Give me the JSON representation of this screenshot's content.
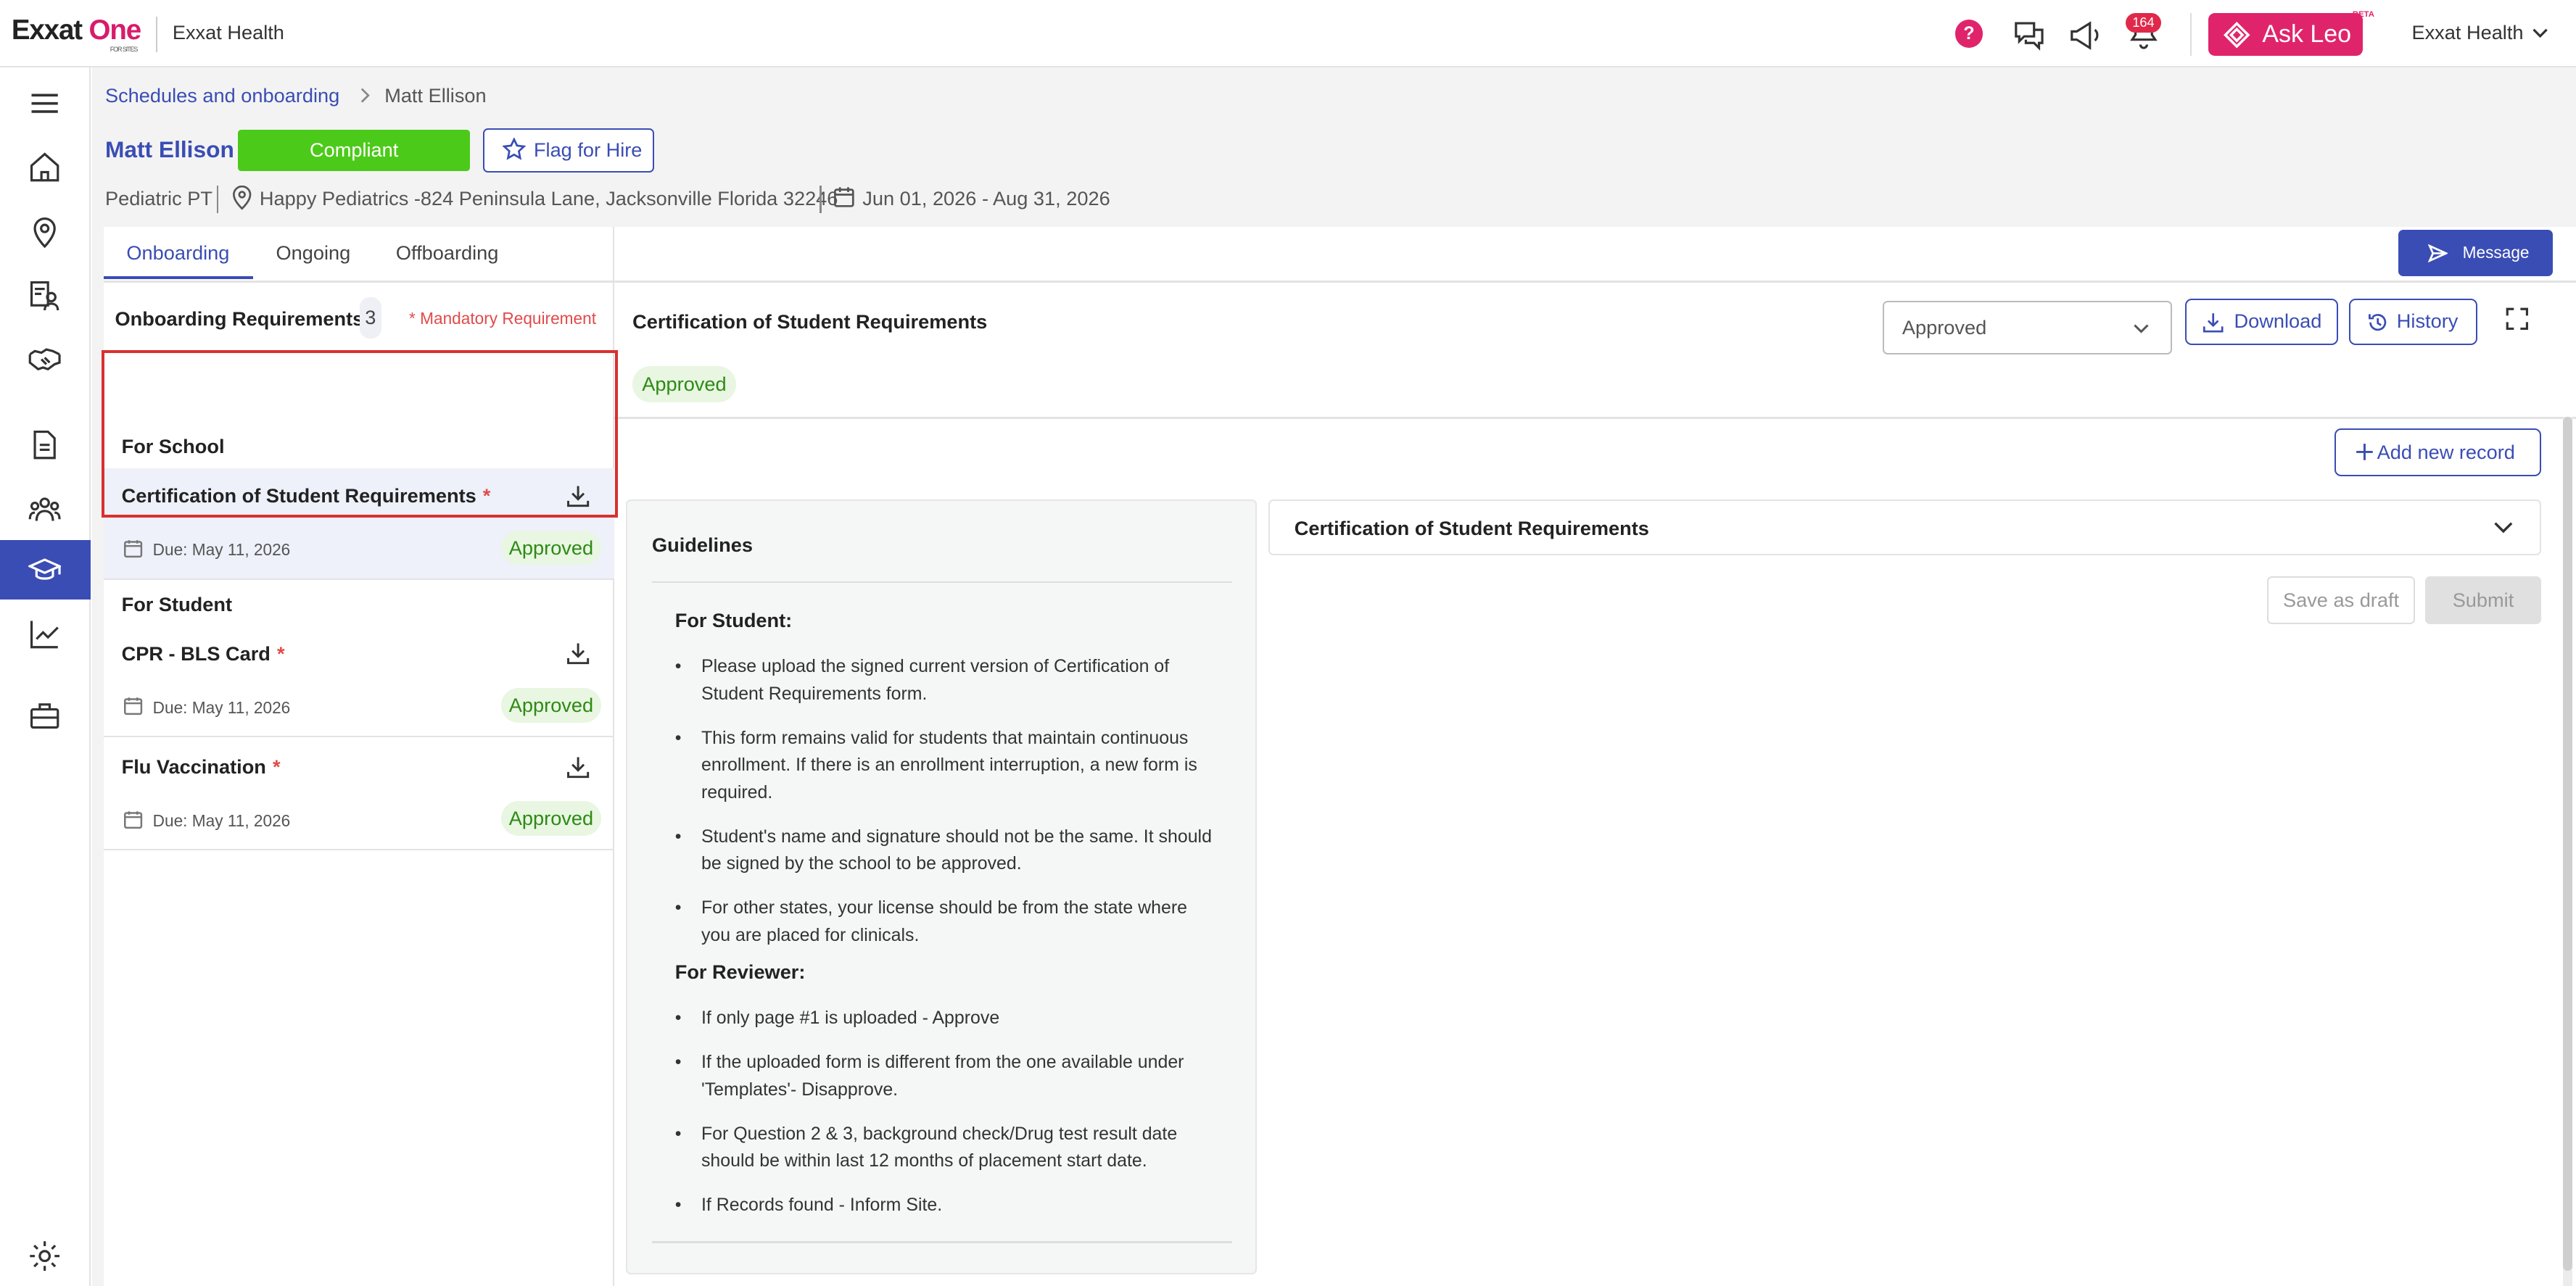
{
  "topbar": {
    "logo_main": "Exxat",
    "logo_accent": "One",
    "logo_sub": "FOR SITES",
    "org": "Exxat Health",
    "help": "?",
    "notifications_count": "164",
    "ask_leo": "Ask Leo",
    "beta": "BETA",
    "org_menu": "Exxat Health"
  },
  "sidenav": {
    "items": [
      "menu-icon",
      "home-icon",
      "location-pin-icon",
      "user-records-icon",
      "handshake-icon",
      "document-icon",
      "people-icon",
      "graduation-cap-icon",
      "trending-chart-icon",
      "briefcase-icon",
      "settings-icon"
    ],
    "active": "graduation-cap-icon"
  },
  "breadcrumb": {
    "parent": "Schedules and onboarding",
    "current": "Matt Ellison"
  },
  "student": {
    "name": "Matt Ellison",
    "status": "Compliant",
    "flag_label": "Flag for Hire",
    "program": "Pediatric PT",
    "location": "Happy Pediatrics -824 Peninsula Lane, Jacksonville Florida 32246",
    "dates": "Jun 01, 2026 - Aug 31, 2026"
  },
  "tabs": [
    {
      "label": "Onboarding",
      "active": true
    },
    {
      "label": "Ongoing"
    },
    {
      "label": "Offboarding"
    }
  ],
  "requirements": {
    "header": "Onboarding Requirements",
    "count": "3",
    "mandatory_note": "* Mandatory Requirement",
    "group_school": "For School",
    "group_student": "For Student",
    "items": [
      {
        "name": "Certification of Student Requirements",
        "mandatory": "*",
        "due": "Due: May 11, 2026",
        "status": "Approved"
      },
      {
        "name": "CPR - BLS Card",
        "mandatory": "*",
        "due": "Due: May 11, 2026",
        "status": "Approved"
      },
      {
        "name": "Flu Vaccination",
        "mandatory": "*",
        "due": "Due: May 11, 2026",
        "status": "Approved"
      }
    ]
  },
  "detail": {
    "message_label": "Message",
    "title": "Certification of Student Requirements",
    "status": "Approved",
    "dropdown_value": "Approved",
    "download_label": "Download",
    "history_label": "History",
    "add_record_label": "Add new record",
    "accordion_title": "Certification of Student Requirements",
    "save_draft_label": "Save as draft",
    "submit_label": "Submit"
  },
  "guidelines": {
    "title": "Guidelines",
    "student_heading": "For Student:",
    "student_items": [
      "Please upload the signed current version of Certification of Student Requirements form.",
      "This form remains valid for students that maintain continuous enrollment. If there is an enrollment interruption, a new form is required.",
      "Student's name and signature should not be the same. It should be signed by the school to be approved.",
      "For other states, your license should be from the state where you are placed for clinicals."
    ],
    "reviewer_heading": "For Reviewer:",
    "reviewer_items": [
      "If only page #1 is uploaded - Approve",
      "If the uploaded form is different from the one available under 'Templates'- Disapprove.",
      "For Question 2 & 3, background check/Drug test result date should be within last 12 months of placement start date.",
      "If Records found - Inform Site."
    ]
  },
  "colors": {
    "primary": "#3a4db4",
    "brand_pink": "#e0246b",
    "compliant": "#4cca1a",
    "approved_text": "#2e8a14",
    "approved_bg": "#e8f6e2",
    "highlight": "#d93030"
  }
}
